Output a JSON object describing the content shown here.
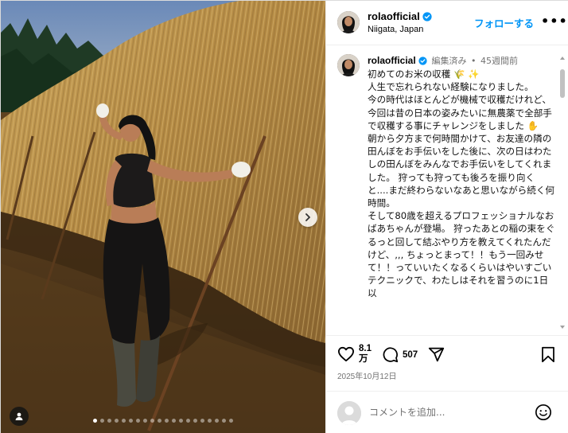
{
  "post": {
    "username": "rolaofficial",
    "location": "Niigata, Japan",
    "follow_label": "フォローする",
    "more_label": "•••",
    "edited_label": "編集済み",
    "separator": " • ",
    "time_ago": "45週間前",
    "caption": "初めてのお米の収穫 🌾 ✨\n人生で忘れられない経験になりました。\n今の時代はほとんどが機械で収穫だけれど、今回は昔の日本の姿みたいに無農薬で全部手で収穫する事にチャレンジをしました ✋\n朝から夕方まで何時間かけて、お友達の隣の田んぼをお手伝いをした後に、次の日はわたしの田んぼをみんなでお手伝いをしてくれました。 狩っても狩っても後ろを振り向くと....まだ終わらないなあと思いながら続く何時間。\nそして80歳を超えるプロフェッショナルなおばあちゃんが登場。 狩ったあとの稲の束をぐるっと回して結ぶやり方を教えてくれたんだけど、,,, ちょっとまって！！もう一回みせて！！っていいたくなるくらいはやいすごいテクニックで、わたしはそれを習うのに1日以",
    "likes": "8.1\n万",
    "comments": "507",
    "date": "2025年10月12日",
    "comment_placeholder": "コメントを追加..."
  },
  "carousel": {
    "dot_count": 20,
    "active_index": 0
  },
  "colors": {
    "accent": "#0095f6",
    "verified": "#0095f6",
    "muted": "#737373"
  },
  "icons": [
    "verified-badge-icon",
    "chevron-right-icon",
    "user-tag-icon",
    "heart-icon",
    "comment-icon",
    "share-icon",
    "bookmark-icon",
    "emoji-icon"
  ]
}
